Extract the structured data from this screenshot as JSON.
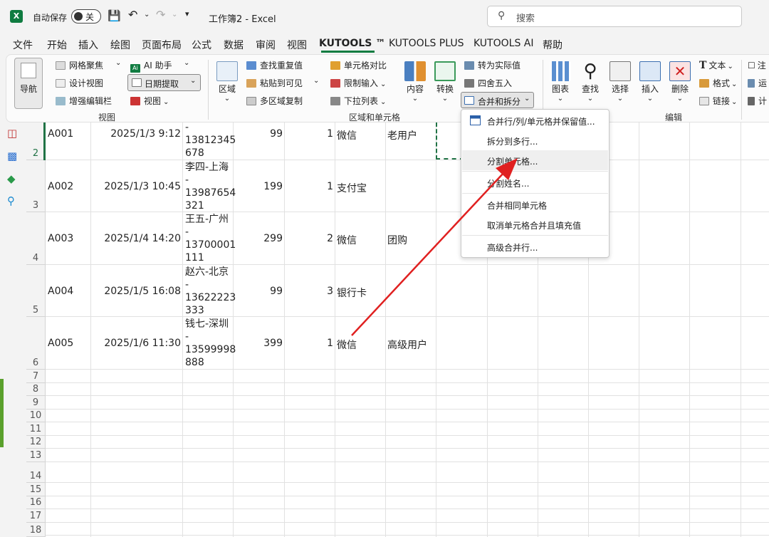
{
  "titlebar": {
    "autosave_label": "自动保存",
    "autosave_state": "关",
    "file_title": "工作簿2 - Excel",
    "search_placeholder": "搜索"
  },
  "menu": {
    "tabs": [
      "文件",
      "开始",
      "插入",
      "绘图",
      "页面布局",
      "公式",
      "数据",
      "审阅",
      "视图",
      "KUTOOLS ™",
      "KUTOOLS PLUS",
      "KUTOOLS AI",
      "帮助"
    ],
    "active": "KUTOOLS ™",
    "active_color": "#107c41"
  },
  "ribbon": {
    "view_group": {
      "nav": "导航",
      "grid_focus": "网格聚焦",
      "design_view": "设计视图",
      "enhanced_edit": "增强编辑栏",
      "ai_assistant": "AI 助手",
      "date_extract": "日期提取",
      "view": "视图",
      "label": "视图"
    },
    "range_group": {
      "area": "区域",
      "find_dup": "查找重复值",
      "paste_visible": "粘贴到可见",
      "multi_copy": "多区域复制",
      "cell_compare": "单元格对比",
      "limit_input": "限制输入",
      "dropdown_list": "下拉列表",
      "content": "内容",
      "convert": "转换",
      "to_actual": "转为实际值",
      "round": "四舍五入",
      "merge_split": "合并和拆分",
      "label": "区域和单元格"
    },
    "edit_group": {
      "chart": "图表",
      "find": "查找",
      "select": "选择",
      "insert": "插入",
      "delete": "删除",
      "text": "文本",
      "format": "格式",
      "link": "链接",
      "comment_partial": "注",
      "run_partial": "运",
      "calc_partial": "计",
      "label": "编辑"
    }
  },
  "rows": [
    {
      "num": "2",
      "id": "A001",
      "datetime": "2025/1/3 9:12",
      "info": "-\n13812345\n678",
      "amount": "99",
      "qty": "1",
      "payment": "微信",
      "note": "老用户"
    },
    {
      "num": "3",
      "id": "A002",
      "datetime": "2025/1/3 10:45",
      "info": "李四-上海\n-\n13987654\n321",
      "amount": "199",
      "qty": "1",
      "payment": "支付宝",
      "note": ""
    },
    {
      "num": "4",
      "id": "A003",
      "datetime": "2025/1/4 14:20",
      "info": "王五-广州\n-\n13700001\n111",
      "amount": "299",
      "qty": "2",
      "payment": "微信",
      "note": "团购"
    },
    {
      "num": "5",
      "id": "A004",
      "datetime": "2025/1/5 16:08",
      "info": "赵六-北京\n-\n13622223\n333",
      "amount": "99",
      "qty": "3",
      "payment": "银行卡",
      "note": ""
    },
    {
      "num": "6",
      "id": "A005",
      "datetime": "2025/1/6 11:30",
      "info": "钱七-深圳\n-\n13599998\n888",
      "amount": "399",
      "qty": "1",
      "payment": "微信",
      "note": "高级用户"
    }
  ],
  "empty_rows": [
    "7",
    "8",
    "9",
    "10",
    "11",
    "12",
    "13",
    "14",
    "15",
    "16",
    "17",
    "18"
  ],
  "dropdown": {
    "items": [
      "合并行/列/单元格并保留值...",
      "拆分到多行...",
      "分割单元格...",
      "分割姓名...",
      "合并相同单元格",
      "取消单元格合并且填充值",
      "高级合并行..."
    ],
    "highlighted": "分割单元格..."
  },
  "annotation": {
    "arrow_color": "#e02020"
  }
}
